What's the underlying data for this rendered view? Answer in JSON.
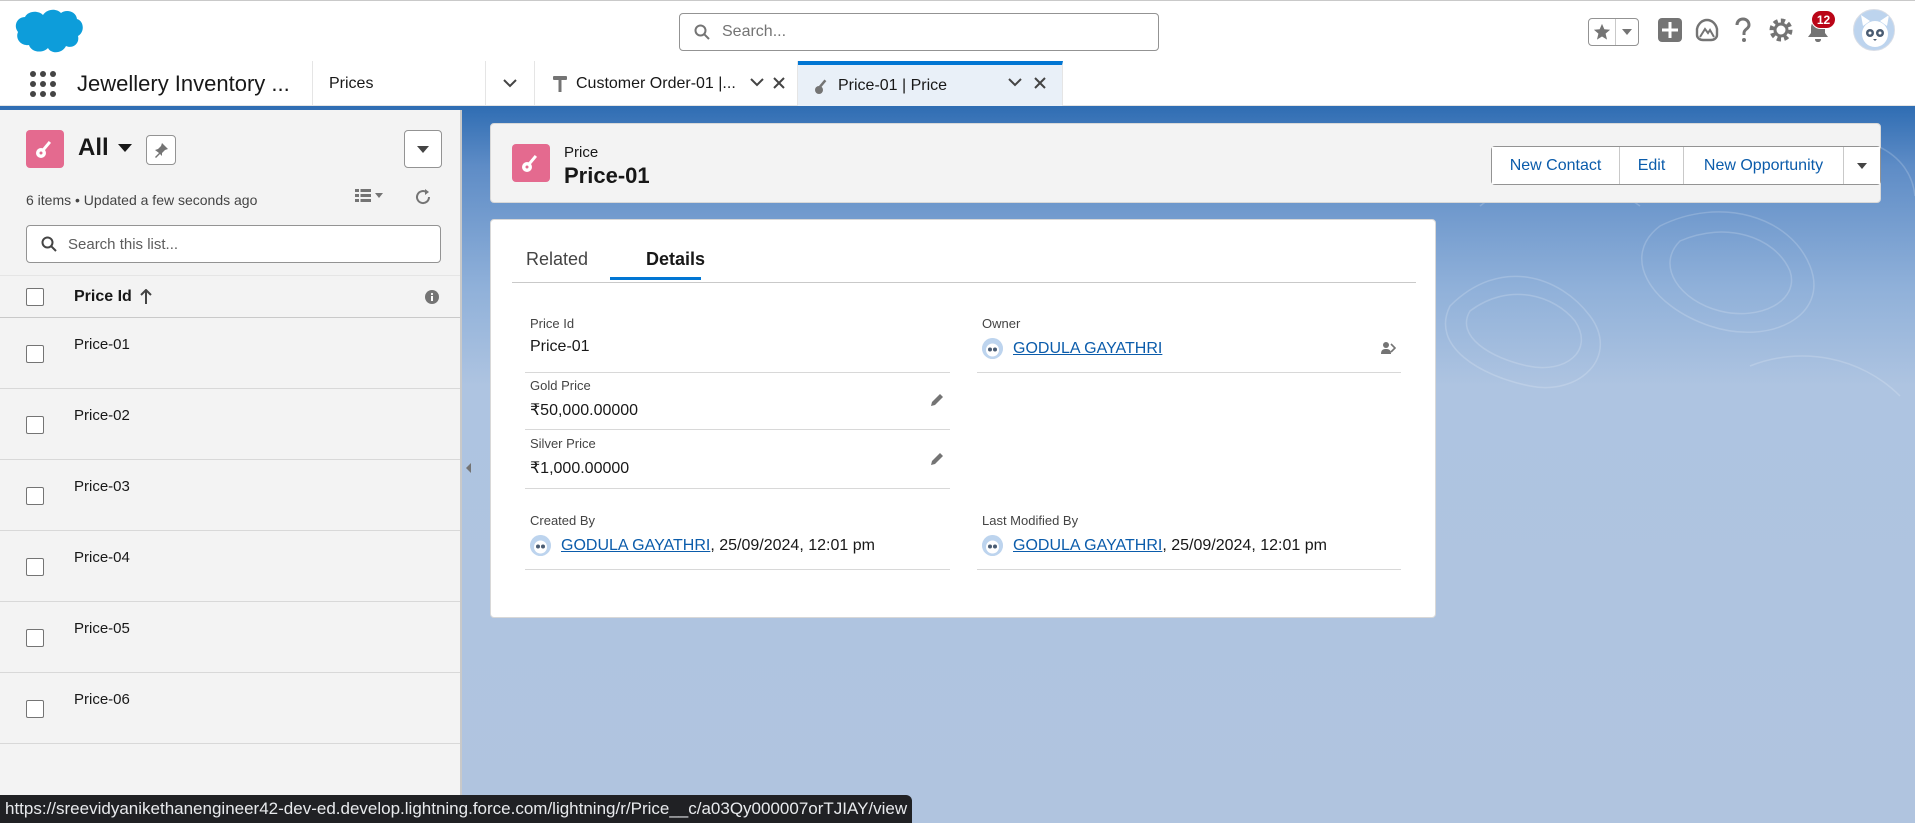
{
  "header": {
    "search_placeholder": "Search...",
    "notification_count": "12"
  },
  "nav": {
    "app_name": "Jewellery Inventory ...",
    "object_nav": "Prices",
    "tabs": [
      {
        "label": "Customer Order-01 |..."
      },
      {
        "label": "Price-01 | Price"
      }
    ]
  },
  "list_view": {
    "title": "All",
    "meta": "6 items • Updated a few seconds ago",
    "search_placeholder": "Search this list...",
    "column": "Price Id",
    "rows": [
      "Price-01",
      "Price-02",
      "Price-03",
      "Price-04",
      "Price-05",
      "Price-06"
    ]
  },
  "record": {
    "type": "Price",
    "name": "Price-01",
    "actions": {
      "new_contact": "New Contact",
      "edit": "Edit",
      "new_opportunity": "New Opportunity"
    },
    "tabs": {
      "related": "Related",
      "details": "Details"
    },
    "fields": {
      "price_id": {
        "label": "Price Id",
        "value": "Price-01"
      },
      "owner": {
        "label": "Owner",
        "value": "GODULA GAYATHRI"
      },
      "gold_price": {
        "label": "Gold Price",
        "value": "₹50,000.00000"
      },
      "silver_price": {
        "label": "Silver Price",
        "value": "₹1,000.00000"
      },
      "created_by": {
        "label": "Created By",
        "user": "GODULA GAYATHRI",
        "date": ", 25/09/2024, 12:01 pm"
      },
      "last_modified_by": {
        "label": "Last Modified By",
        "user": "GODULA GAYATHRI",
        "date": ", 25/09/2024, 12:01 pm"
      }
    }
  },
  "status_url": "https://sreevidyanikethanengineer42-dev-ed.develop.lightning.force.com/lightning/r/Price__c/a03Qy000007orTJIAY/view",
  "colors": {
    "brand_blue": "#0176d3",
    "link": "#0b5cab",
    "price_icon": "#e46a8f",
    "badge": "#ba0517"
  }
}
